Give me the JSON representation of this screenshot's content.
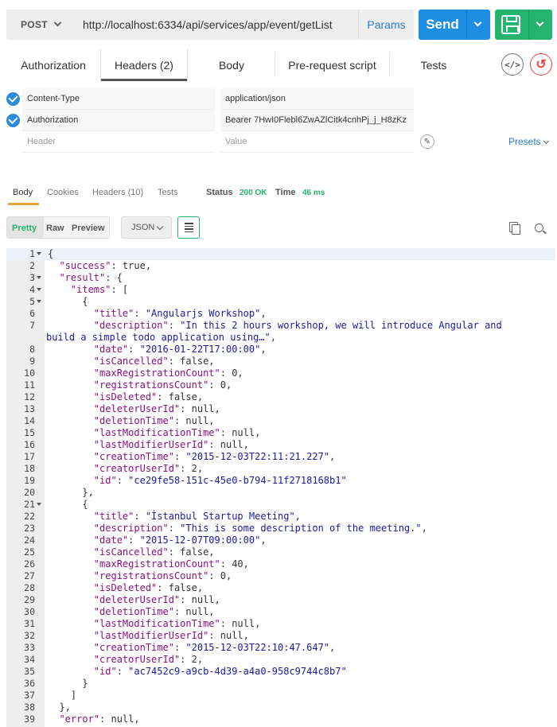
{
  "request": {
    "method": "POST",
    "url": "http://localhost:6334/api/services/app/event/getList",
    "params_label": "Params",
    "send_label": "Send"
  },
  "tabs": [
    {
      "label": "Authorization"
    },
    {
      "label": "Headers (2)"
    },
    {
      "label": "Body"
    },
    {
      "label": "Pre-request script"
    },
    {
      "label": "Tests"
    }
  ],
  "headers": [
    {
      "key": "Content-Type",
      "value": "application/json"
    },
    {
      "key": "Authorization",
      "value": "Bearer 7HwI0Flebl6ZwAZlCitk4cnhPj_j_H8zKz"
    }
  ],
  "header_placeholders": {
    "key": "Header",
    "value": "Value"
  },
  "presets_label": "Presets",
  "response_tabs": {
    "body": "Body",
    "cookies": "Cookies",
    "headers": "Headers (10)",
    "tests": "Tests",
    "status_label": "Status",
    "status_value": "200 OK",
    "time_label": "Time",
    "time_value": "46 ms"
  },
  "view": {
    "pretty": "Pretty",
    "raw": "Raw",
    "preview": "Preview",
    "format": "JSON"
  },
  "code_lines": [
    [
      {
        "t": "p",
        "v": "{"
      }
    ],
    [
      {
        "t": "p",
        "v": "  "
      },
      {
        "t": "k",
        "v": "\"success\""
      },
      {
        "t": "p",
        "v": ": true,"
      }
    ],
    [
      {
        "t": "p",
        "v": "  "
      },
      {
        "t": "k",
        "v": "\"result\""
      },
      {
        "t": "p",
        "v": ": {"
      }
    ],
    [
      {
        "t": "p",
        "v": "    "
      },
      {
        "t": "k",
        "v": "\"items\""
      },
      {
        "t": "p",
        "v": ": ["
      }
    ],
    [
      {
        "t": "p",
        "v": "      {"
      }
    ],
    [
      {
        "t": "p",
        "v": "        "
      },
      {
        "t": "k",
        "v": "\"title\""
      },
      {
        "t": "p",
        "v": ": "
      },
      {
        "t": "s",
        "v": "\"Angularjs Workshop\""
      },
      {
        "t": "p",
        "v": ","
      }
    ],
    [
      {
        "t": "p",
        "v": "        "
      },
      {
        "t": "k",
        "v": "\"description\""
      },
      {
        "t": "p",
        "v": ": "
      },
      {
        "t": "s",
        "v": "\"In this 2 hours workshop, we will introduce Angular and"
      }
    ],
    [
      {
        "t": "s",
        "v": "build a simple todo application using…\""
      },
      {
        "t": "p",
        "v": ","
      }
    ],
    [
      {
        "t": "p",
        "v": "        "
      },
      {
        "t": "k",
        "v": "\"date\""
      },
      {
        "t": "p",
        "v": ": "
      },
      {
        "t": "s",
        "v": "\"2016-01-22T17:00:00\""
      },
      {
        "t": "p",
        "v": ","
      }
    ],
    [
      {
        "t": "p",
        "v": "        "
      },
      {
        "t": "k",
        "v": "\"isCancelled\""
      },
      {
        "t": "p",
        "v": ": false,"
      }
    ],
    [
      {
        "t": "p",
        "v": "        "
      },
      {
        "t": "k",
        "v": "\"maxRegistrationCount\""
      },
      {
        "t": "p",
        "v": ": 0,"
      }
    ],
    [
      {
        "t": "p",
        "v": "        "
      },
      {
        "t": "k",
        "v": "\"registrationsCount\""
      },
      {
        "t": "p",
        "v": ": 0,"
      }
    ],
    [
      {
        "t": "p",
        "v": "        "
      },
      {
        "t": "k",
        "v": "\"isDeleted\""
      },
      {
        "t": "p",
        "v": ": false,"
      }
    ],
    [
      {
        "t": "p",
        "v": "        "
      },
      {
        "t": "k",
        "v": "\"deleterUserId\""
      },
      {
        "t": "p",
        "v": ": null,"
      }
    ],
    [
      {
        "t": "p",
        "v": "        "
      },
      {
        "t": "k",
        "v": "\"deletionTime\""
      },
      {
        "t": "p",
        "v": ": null,"
      }
    ],
    [
      {
        "t": "p",
        "v": "        "
      },
      {
        "t": "k",
        "v": "\"lastModificationTime\""
      },
      {
        "t": "p",
        "v": ": null,"
      }
    ],
    [
      {
        "t": "p",
        "v": "        "
      },
      {
        "t": "k",
        "v": "\"lastModifierUserId\""
      },
      {
        "t": "p",
        "v": ": null,"
      }
    ],
    [
      {
        "t": "p",
        "v": "        "
      },
      {
        "t": "k",
        "v": "\"creationTime\""
      },
      {
        "t": "p",
        "v": ": "
      },
      {
        "t": "s",
        "v": "\"2015-12-03T22:11:21.227\""
      },
      {
        "t": "p",
        "v": ","
      }
    ],
    [
      {
        "t": "p",
        "v": "        "
      },
      {
        "t": "k",
        "v": "\"creatorUserId\""
      },
      {
        "t": "p",
        "v": ": 2,"
      }
    ],
    [
      {
        "t": "p",
        "v": "        "
      },
      {
        "t": "k",
        "v": "\"id\""
      },
      {
        "t": "p",
        "v": ": "
      },
      {
        "t": "s",
        "v": "\"ce29fe58-151c-45e0-b794-11f2718168b1\""
      }
    ],
    [
      {
        "t": "p",
        "v": "      },"
      }
    ],
    [
      {
        "t": "p",
        "v": "      {"
      }
    ],
    [
      {
        "t": "p",
        "v": "        "
      },
      {
        "t": "k",
        "v": "\"title\""
      },
      {
        "t": "p",
        "v": ": "
      },
      {
        "t": "s",
        "v": "\"İstanbul Startup Meeting\""
      },
      {
        "t": "p",
        "v": ","
      }
    ],
    [
      {
        "t": "p",
        "v": "        "
      },
      {
        "t": "k",
        "v": "\"description\""
      },
      {
        "t": "p",
        "v": ": "
      },
      {
        "t": "s",
        "v": "\"This is some description of the meeting.\""
      },
      {
        "t": "p",
        "v": ","
      }
    ],
    [
      {
        "t": "p",
        "v": "        "
      },
      {
        "t": "k",
        "v": "\"date\""
      },
      {
        "t": "p",
        "v": ": "
      },
      {
        "t": "s",
        "v": "\"2015-12-07T09:00:00\""
      },
      {
        "t": "p",
        "v": ","
      }
    ],
    [
      {
        "t": "p",
        "v": "        "
      },
      {
        "t": "k",
        "v": "\"isCancelled\""
      },
      {
        "t": "p",
        "v": ": false,"
      }
    ],
    [
      {
        "t": "p",
        "v": "        "
      },
      {
        "t": "k",
        "v": "\"maxRegistrationCount\""
      },
      {
        "t": "p",
        "v": ": 40,"
      }
    ],
    [
      {
        "t": "p",
        "v": "        "
      },
      {
        "t": "k",
        "v": "\"registrationsCount\""
      },
      {
        "t": "p",
        "v": ": 0,"
      }
    ],
    [
      {
        "t": "p",
        "v": "        "
      },
      {
        "t": "k",
        "v": "\"isDeleted\""
      },
      {
        "t": "p",
        "v": ": false,"
      }
    ],
    [
      {
        "t": "p",
        "v": "        "
      },
      {
        "t": "k",
        "v": "\"deleterUserId\""
      },
      {
        "t": "p",
        "v": ": null,"
      }
    ],
    [
      {
        "t": "p",
        "v": "        "
      },
      {
        "t": "k",
        "v": "\"deletionTime\""
      },
      {
        "t": "p",
        "v": ": null,"
      }
    ],
    [
      {
        "t": "p",
        "v": "        "
      },
      {
        "t": "k",
        "v": "\"lastModificationTime\""
      },
      {
        "t": "p",
        "v": ": null,"
      }
    ],
    [
      {
        "t": "p",
        "v": "        "
      },
      {
        "t": "k",
        "v": "\"lastModifierUserId\""
      },
      {
        "t": "p",
        "v": ": null,"
      }
    ],
    [
      {
        "t": "p",
        "v": "        "
      },
      {
        "t": "k",
        "v": "\"creationTime\""
      },
      {
        "t": "p",
        "v": ": "
      },
      {
        "t": "s",
        "v": "\"2015-12-03T22:10:47.647\""
      },
      {
        "t": "p",
        "v": ","
      }
    ],
    [
      {
        "t": "p",
        "v": "        "
      },
      {
        "t": "k",
        "v": "\"creatorUserId\""
      },
      {
        "t": "p",
        "v": ": 2,"
      }
    ],
    [
      {
        "t": "p",
        "v": "        "
      },
      {
        "t": "k",
        "v": "\"id\""
      },
      {
        "t": "p",
        "v": ": "
      },
      {
        "t": "s",
        "v": "\"ac7452c9-a9cb-4d39-a4a0-958c9744c8b7\""
      }
    ],
    [
      {
        "t": "p",
        "v": "      }"
      }
    ],
    [
      {
        "t": "p",
        "v": "    ]"
      }
    ],
    [
      {
        "t": "p",
        "v": "  },"
      }
    ],
    [
      {
        "t": "p",
        "v": "  "
      },
      {
        "t": "k",
        "v": "\"error\""
      },
      {
        "t": "p",
        "v": ": null,"
      }
    ]
  ],
  "line_numbers": [
    "1",
    "2",
    "3",
    "4",
    "5",
    "6",
    "7",
    "",
    "8",
    "9",
    "10",
    "11",
    "12",
    "13",
    "14",
    "15",
    "16",
    "17",
    "18",
    "19",
    "20",
    "21",
    "22",
    "23",
    "24",
    "25",
    "26",
    "27",
    "28",
    "29",
    "30",
    "31",
    "32",
    "33",
    "34",
    "35",
    "36",
    "37",
    "38",
    "39"
  ],
  "fold_lines": [
    "1",
    "3",
    "4",
    "5",
    "21"
  ]
}
